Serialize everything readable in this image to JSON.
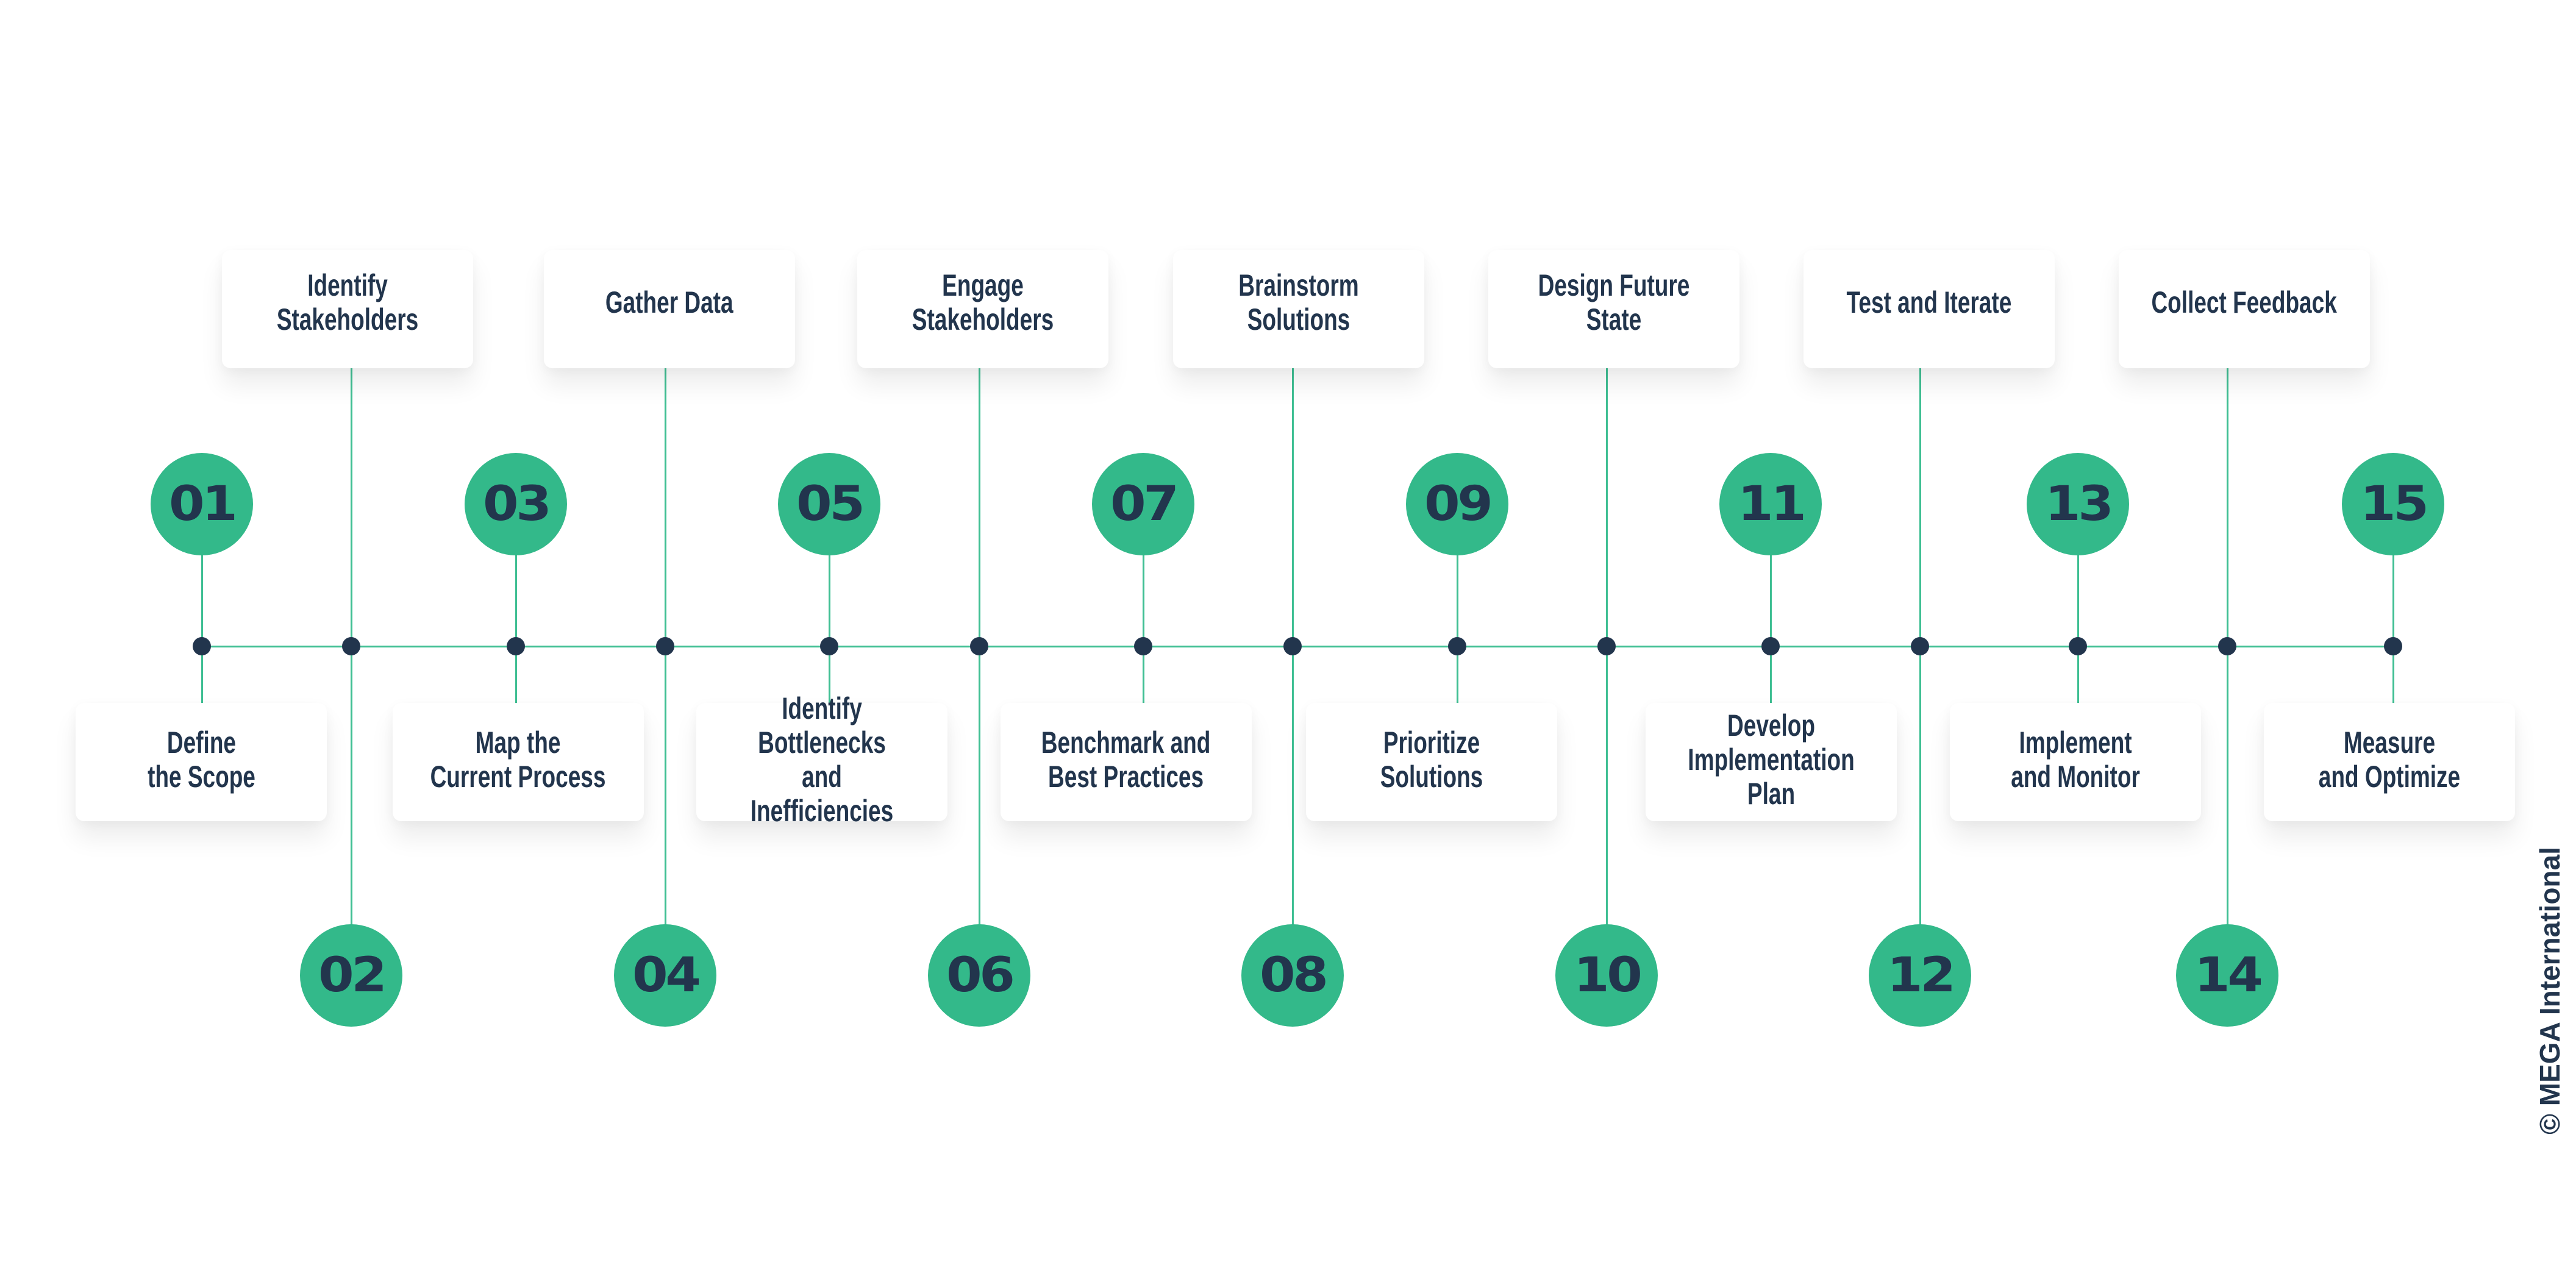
{
  "diagram": {
    "type": "timeline",
    "colors": {
      "accent_green": "#33B98A",
      "line_green": "#3FBF93",
      "navy": "#22354D",
      "box_bg": "#FFFFFF"
    },
    "steps": [
      {
        "number": "01",
        "label": "Define\nthe Scope",
        "position": "bottom"
      },
      {
        "number": "02",
        "label": "Identify\nStakeholders",
        "position": "top"
      },
      {
        "number": "03",
        "label": "Map the\nCurrent Process",
        "position": "bottom"
      },
      {
        "number": "04",
        "label": "Gather Data",
        "position": "top"
      },
      {
        "number": "05",
        "label": "Identify Bottlenecks\nand Inefficiencies",
        "position": "bottom"
      },
      {
        "number": "06",
        "label": "Engage Stakeholders",
        "position": "top"
      },
      {
        "number": "07",
        "label": "Benchmark and\nBest Practices",
        "position": "bottom"
      },
      {
        "number": "08",
        "label": "Brainstorm Solutions",
        "position": "top"
      },
      {
        "number": "09",
        "label": "Prioritize Solutions",
        "position": "bottom"
      },
      {
        "number": "10",
        "label": "Design Future State",
        "position": "top"
      },
      {
        "number": "11",
        "label": "Develop\nImplementation Plan",
        "position": "bottom"
      },
      {
        "number": "12",
        "label": "Test and Iterate",
        "position": "top"
      },
      {
        "number": "13",
        "label": "Implement\nand Monitor",
        "position": "bottom"
      },
      {
        "number": "14",
        "label": "Collect Feedback",
        "position": "top"
      },
      {
        "number": "15",
        "label": "Measure\nand Optimize",
        "position": "bottom"
      }
    ]
  },
  "footer": {
    "copyright": "© MEGA International"
  }
}
